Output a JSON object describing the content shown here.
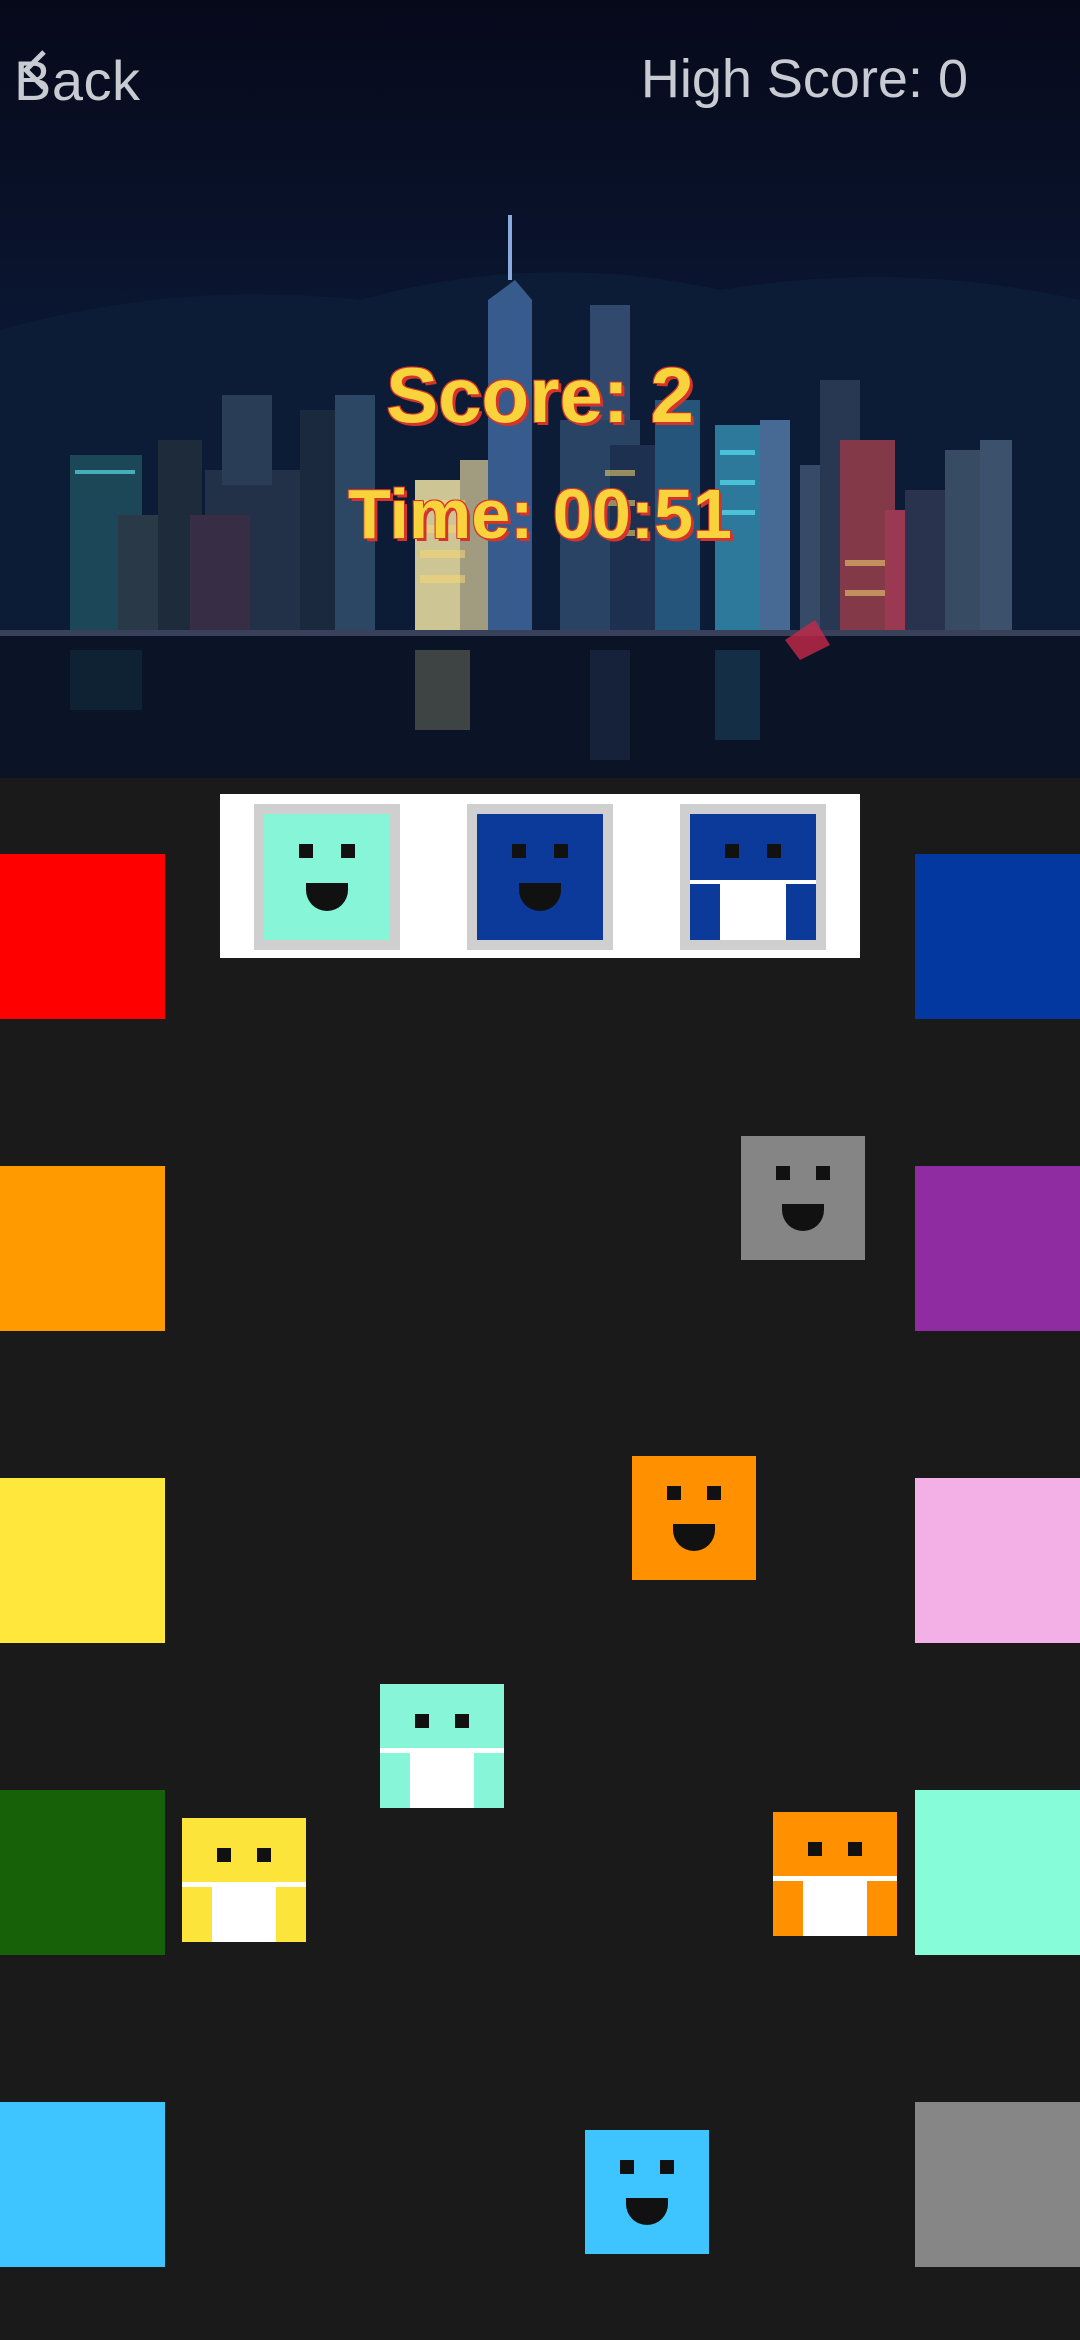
{
  "header": {
    "back_label": "Back",
    "high_score": "High Score: 0",
    "score": "Score: 2",
    "time": "Time: 00:51"
  },
  "icons": {
    "back": "chevron-left-icon"
  },
  "targets": [
    {
      "color": "#86f5d8",
      "style": "smile"
    },
    {
      "color": "#0b3a9a",
      "style": "smile"
    },
    {
      "color": "#0b3a9a",
      "style": "shirt"
    }
  ],
  "bins": {
    "left": [
      "#ff0000",
      "#ff9a00",
      "#ffe83b",
      "#176208",
      "#3ec5ff"
    ],
    "right": [
      "#02389f",
      "#902ca2",
      "#f2b0e6",
      "#86fcd8",
      "#868686"
    ]
  },
  "blocks": [
    {
      "color": "#858585",
      "style": "smile"
    },
    {
      "color": "#ff9000",
      "style": "smile"
    },
    {
      "color": "#86f5d8",
      "style": "shirt"
    },
    {
      "color": "#fde43b",
      "style": "shirt"
    },
    {
      "color": "#ff9000",
      "style": "shirt"
    },
    {
      "color": "#3ec5ff",
      "style": "smile"
    }
  ]
}
